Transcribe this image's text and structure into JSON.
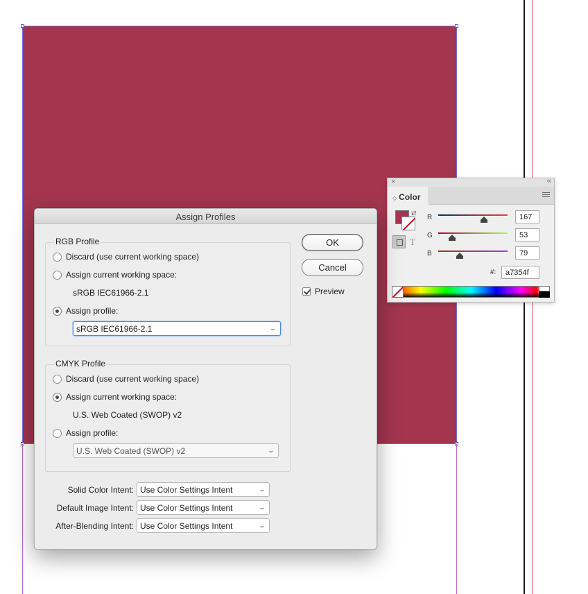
{
  "dialog": {
    "title": "Assign Profiles",
    "rgb": {
      "group_title": "RGB Profile",
      "discard_label": "Discard (use current working space)",
      "assign_current_label": "Assign current working space:",
      "current_space": "sRGB IEC61966-2.1",
      "assign_profile_label": "Assign profile:",
      "selected_option": "assign_profile",
      "profile_value": "sRGB IEC61966-2.1"
    },
    "cmyk": {
      "group_title": "CMYK Profile",
      "discard_label": "Discard (use current working space)",
      "assign_current_label": "Assign current working space:",
      "current_space": "U.S. Web Coated (SWOP) v2",
      "assign_profile_label": "Assign profile:",
      "selected_option": "assign_current",
      "profile_value": "U.S. Web Coated (SWOP) v2"
    },
    "intents": [
      {
        "label": "Solid Color Intent:",
        "value": "Use Color Settings Intent"
      },
      {
        "label": "Default Image Intent:",
        "value": "Use Color Settings Intent"
      },
      {
        "label": "After-Blending Intent:",
        "value": "Use Color Settings Intent"
      }
    ],
    "ok_label": "OK",
    "cancel_label": "Cancel",
    "preview_label": "Preview",
    "preview_checked": true
  },
  "color_panel": {
    "close_glyph": "×",
    "collapse_glyph": "‹‹",
    "tab_label": "Color",
    "tab_arrows": "◇",
    "swap_glyph": "⇄",
    "text_format_glyph": "T",
    "r_label": "R",
    "g_label": "G",
    "b_label": "B",
    "r_value": "167",
    "g_value": "53",
    "b_value": "79",
    "hex_label": "#:",
    "hex_value": "a7354f",
    "fill_color": "#a7354f",
    "icons": [
      "close-icon",
      "collapse-icon",
      "panel-menu-icon",
      "swap-icon",
      "none-swatch-icon"
    ]
  },
  "canvas": {
    "frame_color": "#a3354f",
    "selection_color": "#6f6fd8"
  }
}
